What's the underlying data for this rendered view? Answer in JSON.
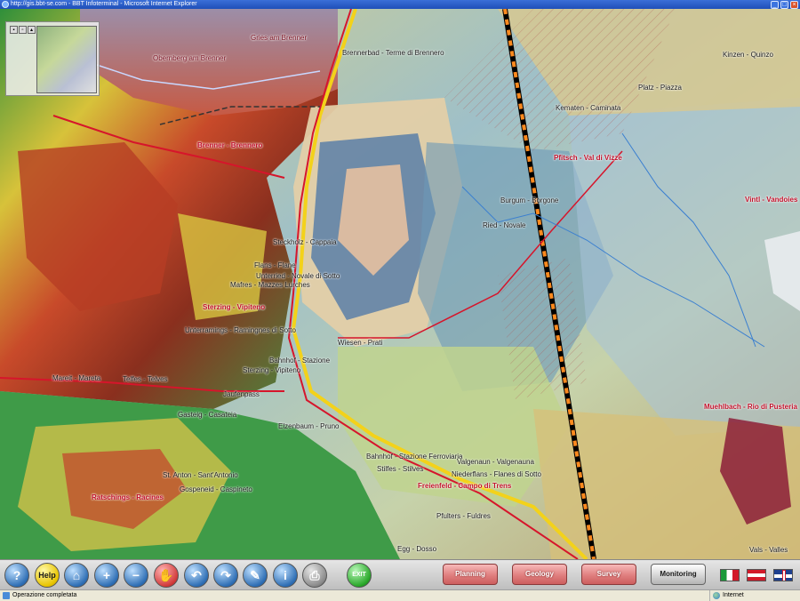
{
  "window": {
    "title": "http://gis.bbt-se.com - BBT Infoterminal - Microsoft Internet Explorer",
    "minimize": "_",
    "maximize": "□",
    "close": "×"
  },
  "map": {
    "places": [
      {
        "id": "gries",
        "text": "Gries am Brenner"
      },
      {
        "id": "obernberg",
        "text": "Obernberg am Brenner"
      },
      {
        "id": "brennerbad",
        "text": "Brennerbad - Terme di Brennero"
      },
      {
        "id": "brenner",
        "text": "Brenner - Brennero"
      },
      {
        "id": "kematen",
        "text": "Kematen - Caminata"
      },
      {
        "id": "kinzen",
        "text": "Kinzen - Quinzo"
      },
      {
        "id": "piazza",
        "text": "Platz - Piazza"
      },
      {
        "id": "pfitsch",
        "text": "Pfitsch - Val di Vizze"
      },
      {
        "id": "vinti",
        "text": "Vintl - Vandoies"
      },
      {
        "id": "burgum",
        "text": "Burgum - Borgone"
      },
      {
        "id": "ried",
        "text": "Ried - Novale"
      },
      {
        "id": "steckholz",
        "text": "Steckholz - Cappaia"
      },
      {
        "id": "flains",
        "text": "Flans - Flane"
      },
      {
        "id": "unterried",
        "text": "Unterried - Novale di Sotto"
      },
      {
        "id": "matres",
        "text": "Mafres - Mazzes Lurches"
      },
      {
        "id": "sterzing",
        "text": "Sterzing - Vipiteno"
      },
      {
        "id": "unterramings",
        "text": "Unterramings - Ramingnes di Sotto"
      },
      {
        "id": "wiesen",
        "text": "Wiesen - Prati"
      },
      {
        "id": "bahnhof1",
        "text": "Bahnhof - Stazione"
      },
      {
        "id": "sterzing2",
        "text": "Sterzing - Vipiteno"
      },
      {
        "id": "mareit",
        "text": "Mareit - Mareta"
      },
      {
        "id": "telfes",
        "text": "Telfes - Telves"
      },
      {
        "id": "jaufenpass",
        "text": "Jaufenpass"
      },
      {
        "id": "gasteig",
        "text": "Gasteig - Casateia"
      },
      {
        "id": "elzenbaum",
        "text": "Elzenbaum - Pruno"
      },
      {
        "id": "bahnhof2",
        "text": "Bahnhof - Stazione Ferroviaria"
      },
      {
        "id": "valgenaun",
        "text": "Valgenaun - Valgenauna"
      },
      {
        "id": "niederflans",
        "text": "Niederflans - Flanes di Sotto"
      },
      {
        "id": "stilfes",
        "text": "Stilfes - Stilves"
      },
      {
        "id": "freienfeld",
        "text": "Freienfeld - Campo di Trens"
      },
      {
        "id": "pfulters",
        "text": "Pfulters - Fuldres"
      },
      {
        "id": "egg",
        "text": "Egg - Dosso"
      },
      {
        "id": "stanton",
        "text": "St. Anton - Sant'Antonio"
      },
      {
        "id": "gospeneid",
        "text": "Gospeneid - Caspineto"
      },
      {
        "id": "ratschings",
        "text": "Ratschings - Racines"
      },
      {
        "id": "muehlbach",
        "text": "Muehlbach - Rio di Pusteria"
      },
      {
        "id": "vals",
        "text": "Vals - Valles"
      }
    ]
  },
  "overview": {
    "buttons": [
      "save-icon",
      "print-icon",
      "lock-icon"
    ]
  },
  "toolbar": {
    "help": "Help",
    "exit": "EXIT",
    "planning": "Planning",
    "geology": "Geology",
    "survey": "Survey",
    "monitoring": "Monitoring",
    "question": "?",
    "info": "i"
  },
  "status": {
    "text": "Operazione completata",
    "zone": "Internet"
  },
  "colors": {
    "titlebar": "#2458c8",
    "pill": "#e07f7f",
    "statusbar": "#ece9d8"
  }
}
